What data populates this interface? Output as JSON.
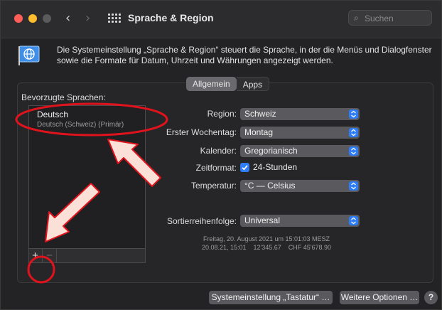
{
  "window": {
    "title": "Sprache & Region",
    "search_placeholder": "Suchen"
  },
  "description": "Die Systemeinstellung „Sprache & Region“ steuert die Sprache, in der die Menüs und Dialogfenster sowie die Formate für Datum, Uhrzeit und Währungen angezeigt werden.",
  "tabs": [
    {
      "label": "Allgemein",
      "active": true
    },
    {
      "label": "Apps",
      "active": false
    }
  ],
  "languages": {
    "heading": "Bevorzugte Sprachen:",
    "items": [
      {
        "name": "Deutsch",
        "detail": "Deutsch (Schweiz) (Primär)"
      }
    ],
    "add_label": "+",
    "remove_label": "−"
  },
  "settings": {
    "region": {
      "label": "Region:",
      "value": "Schweiz"
    },
    "first_weekday": {
      "label": "Erster Wochentag:",
      "value": "Montag"
    },
    "calendar": {
      "label": "Kalender:",
      "value": "Gregorianisch"
    },
    "time_format": {
      "label": "Zeitformat:",
      "value": "24-Stunden",
      "checked": true
    },
    "temperature": {
      "label": "Temperatur:",
      "value": "°C — Celsius"
    },
    "sort_order": {
      "label": "Sortierreihenfolge:",
      "value": "Universal"
    }
  },
  "sample": {
    "line1": "Freitag, 20. August 2021 um 15:01:03 MESZ",
    "line2": "20.08.21, 15:01    12'345.67    CHF 45'678.90"
  },
  "footer": {
    "keyboard_button": "Systemeinstellung „Tastatur“ …",
    "more_options_button": "Weitere Optionen …",
    "help_label": "?"
  },
  "colors": {
    "accent": "#2f7df6",
    "annotation": "#e0131c",
    "arrow_fill": "#fbe0d8"
  },
  "icons": {
    "flag": "flag-globe-icon",
    "search": "search-icon",
    "grid": "grid-icon",
    "back": "chevron-left-icon",
    "forward": "chevron-right-icon"
  }
}
